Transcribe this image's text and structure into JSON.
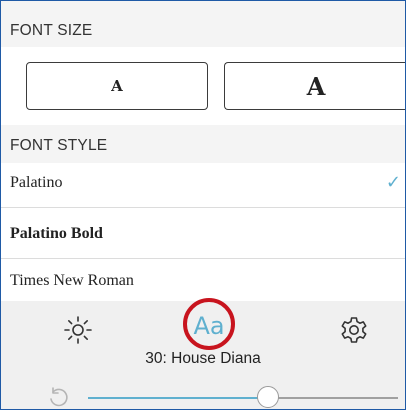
{
  "font_size": {
    "header": "FONT SIZE",
    "small_label": "A",
    "large_label": "A"
  },
  "font_style": {
    "header": "FONT STYLE",
    "items": [
      {
        "label": "Palatino",
        "selected": true
      },
      {
        "label": "Palatino Bold",
        "selected": false
      },
      {
        "label": "Times New Roman",
        "selected": false
      }
    ],
    "check_glyph": "✓"
  },
  "toolbar": {
    "icons": [
      "sun-icon",
      "font-aa-icon",
      "gear-icon"
    ],
    "aa_label": "Aa",
    "page_label": "30: House Diana",
    "slider_value_fraction": 0.63
  },
  "colors": {
    "accent": "#5fb0cf",
    "highlight_circle": "#c8141e"
  }
}
